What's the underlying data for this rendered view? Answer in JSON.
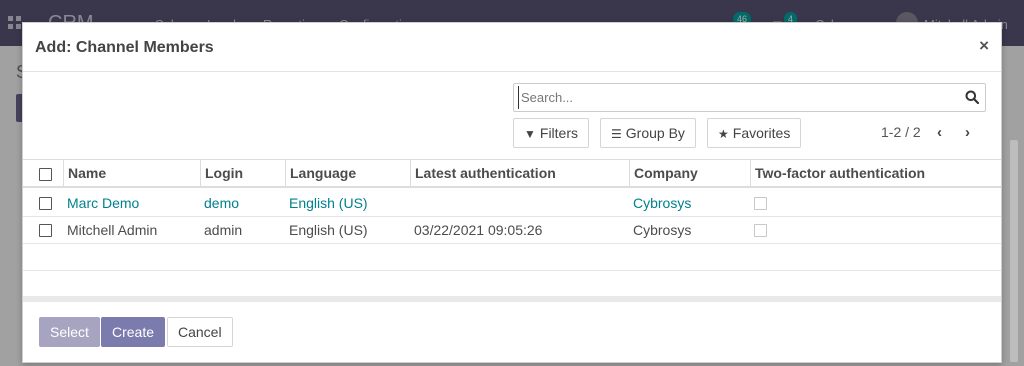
{
  "app": {
    "brand": "CRM",
    "nav": [
      "Sales",
      "Leads",
      "Reporting",
      "Configuration"
    ],
    "messages_count": "46",
    "activities_count": "4",
    "company": "Cybrosys",
    "user": "Mitchell Admin",
    "bg_letter": "S"
  },
  "modal": {
    "title": "Add: Channel Members",
    "close_label": "×"
  },
  "search": {
    "placeholder": "Search..."
  },
  "filters": {
    "filters_label": "Filters",
    "groupby_label": "Group By",
    "favorites_label": "Favorites"
  },
  "pager": {
    "value": "1-2 / 2"
  },
  "table": {
    "columns": [
      "Name",
      "Login",
      "Language",
      "Latest authentication",
      "Company",
      "Two-factor authentication"
    ],
    "rows": [
      {
        "name": "Marc Demo",
        "login": "demo",
        "language": "English (US)",
        "latest_auth": "",
        "company": "Cybrosys",
        "two_factor": false
      },
      {
        "name": "Mitchell Admin",
        "login": "admin",
        "language": "English (US)",
        "latest_auth": "03/22/2021 09:05:26",
        "company": "Cybrosys",
        "two_factor": false
      }
    ]
  },
  "footer": {
    "select_label": "Select",
    "create_label": "Create",
    "cancel_label": "Cancel"
  },
  "colors": {
    "topbar": "#575172",
    "primary": "#7c7bad",
    "primary_disabled": "#a7a4c1",
    "link": "#01808e",
    "badge": "#00a09d"
  }
}
